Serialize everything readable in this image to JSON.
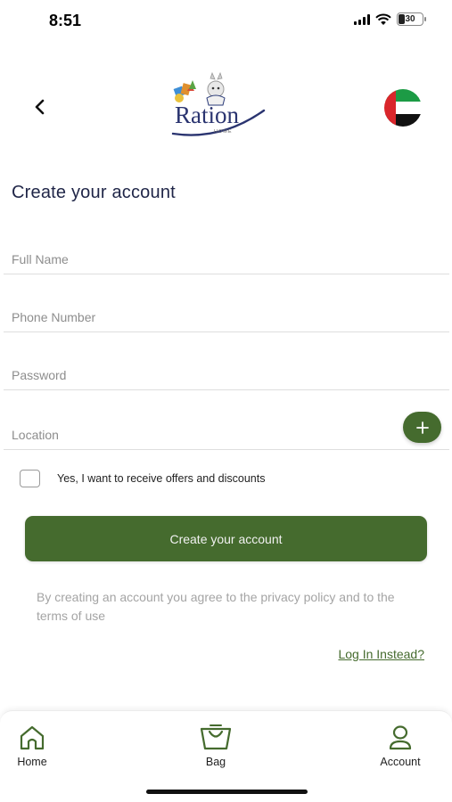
{
  "status_bar": {
    "time": "8:51",
    "battery": "30"
  },
  "header": {
    "brand_name": "Ration",
    "brand_sub": "HOME"
  },
  "page_title": "Create your account",
  "fields": {
    "full_name": {
      "placeholder": "Full Name",
      "value": ""
    },
    "phone": {
      "placeholder": "Phone Number",
      "value": ""
    },
    "password": {
      "placeholder": "Password",
      "value": ""
    },
    "location": {
      "placeholder": "Location",
      "value": ""
    }
  },
  "offers_checkbox": {
    "label": "Yes, I want to receive offers and discounts",
    "checked": false
  },
  "primary_button": {
    "label": "Create your account"
  },
  "agreement_text": "By creating an account you agree to the privacy policy and to the terms of use",
  "login_link": "Log In Instead?",
  "bottom_nav": {
    "items": [
      {
        "label": "Home",
        "icon": "home-icon"
      },
      {
        "label": "Bag",
        "icon": "bag-icon"
      },
      {
        "label": "Account",
        "icon": "account-icon"
      }
    ]
  },
  "colors": {
    "accent": "#456b2e",
    "title": "#1f2547",
    "muted": "#a4a4a4"
  }
}
